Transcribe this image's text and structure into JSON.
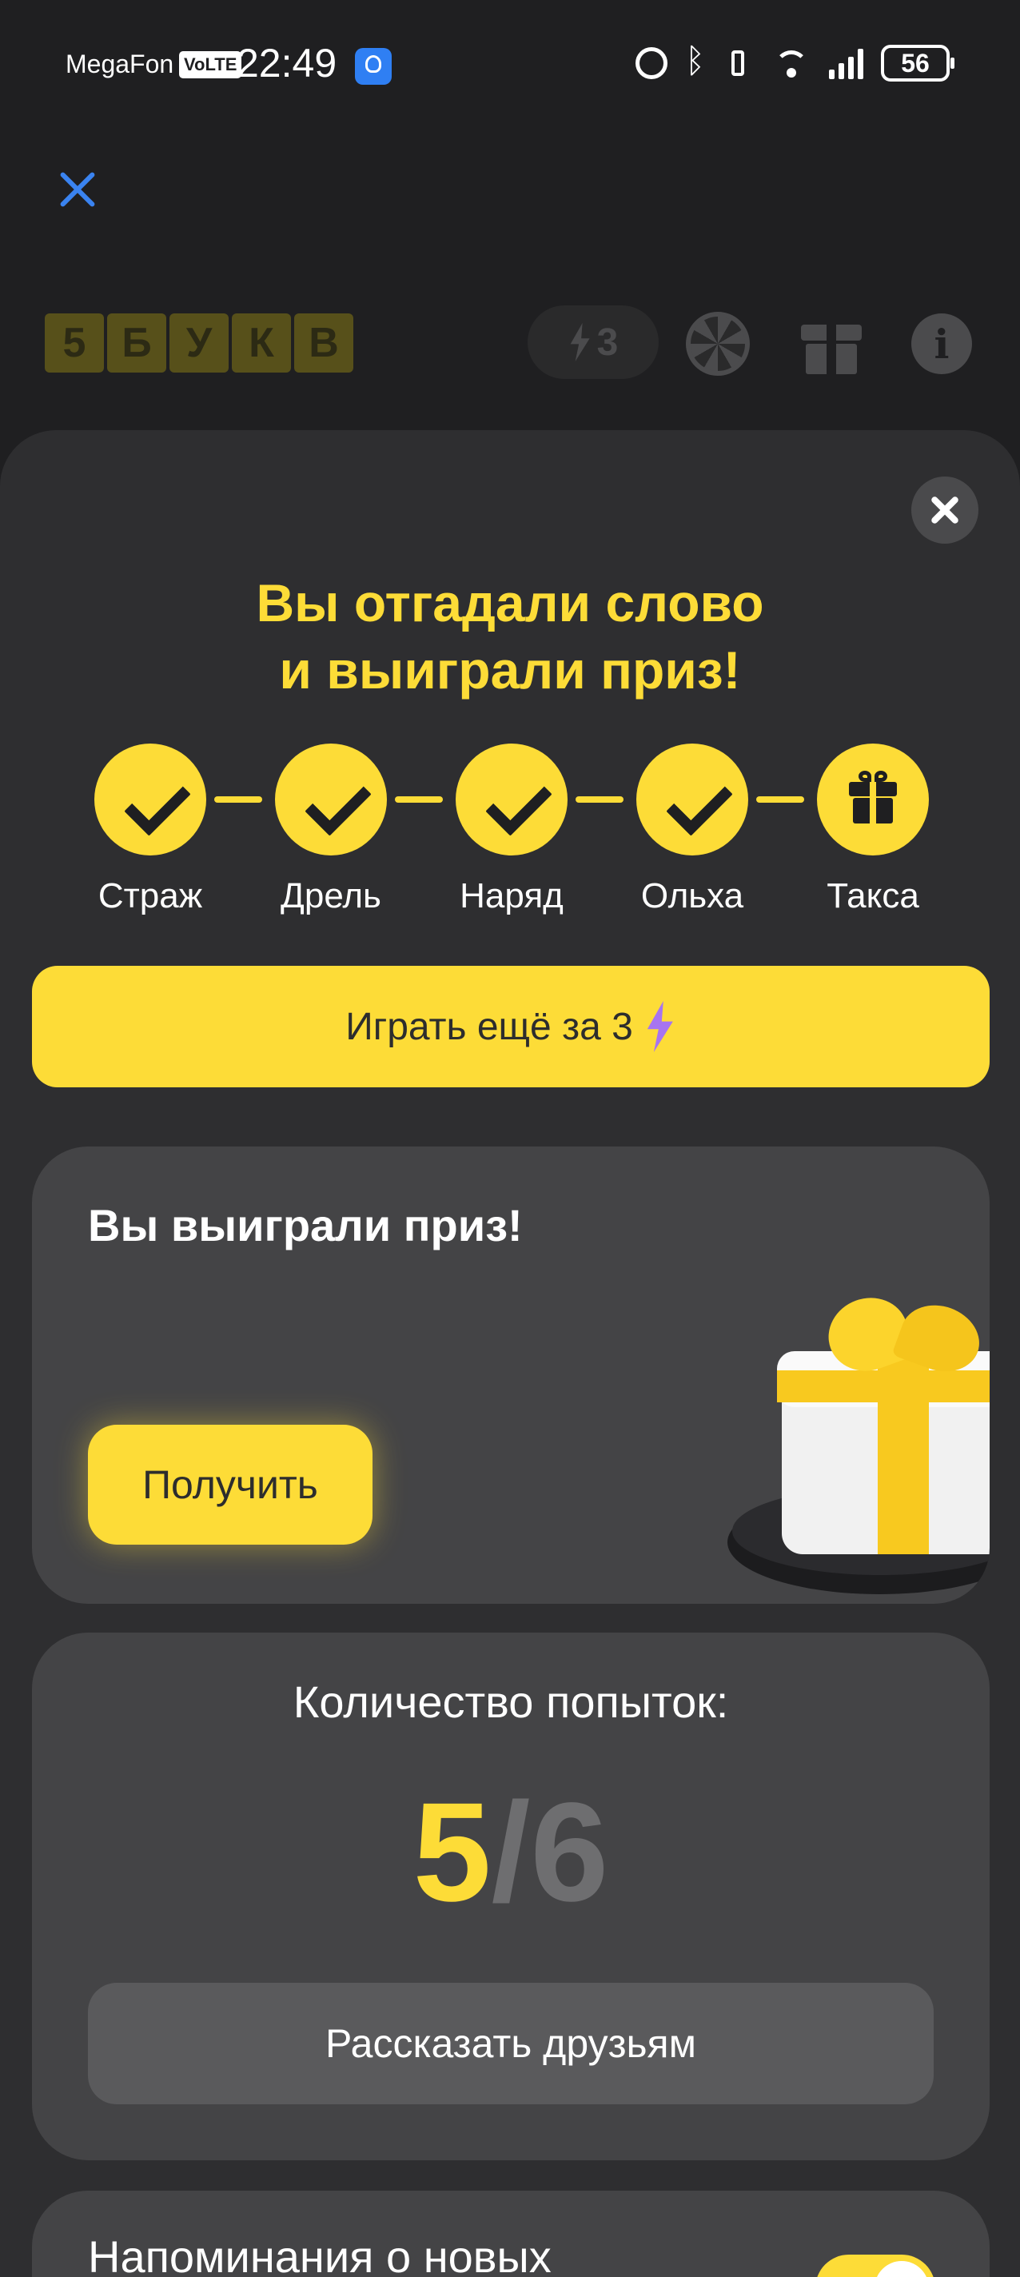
{
  "status_bar": {
    "carrier": "MegaFon",
    "network_badge": "VoLTE",
    "time": "22:49",
    "battery": "56"
  },
  "header": {
    "logo_letters": [
      "5",
      "Б",
      "У",
      "К",
      "В"
    ],
    "energy_count": "3"
  },
  "sheet": {
    "headline_line1": "Вы отгадали слово",
    "headline_line2": "и выиграли приз!",
    "steps": [
      {
        "label": "Страж",
        "state": "done"
      },
      {
        "label": "Дрель",
        "state": "done"
      },
      {
        "label": "Наряд",
        "state": "done"
      },
      {
        "label": "Ольха",
        "state": "done"
      },
      {
        "label": "Такса",
        "state": "gift"
      }
    ],
    "play_again_label": "Играть ещё за 3",
    "prize_card": {
      "title": "Вы выиграли приз!",
      "get_label": "Получить"
    },
    "tries_card": {
      "title": "Количество попыток:",
      "current": "5",
      "separator": "/",
      "total": "6",
      "share_label": "Рассказать друзьям"
    },
    "reminder_card": {
      "title": "Напоминания о новых",
      "toggle_on": true
    }
  },
  "colors": {
    "accent": "#fddc37",
    "background": "#1f1f21",
    "sheet": "#2e2e30",
    "card": "#444446",
    "close_blue": "#3a83f0",
    "bolt_purple": "#a774f0"
  }
}
